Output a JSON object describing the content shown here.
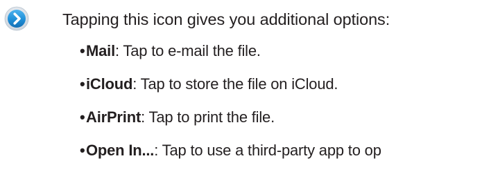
{
  "icon": {
    "name": "disclosure-chevron-icon",
    "fill_color": "#1f8fd8",
    "ring_color": "#d5dde6",
    "glyph_color": "#ffffff"
  },
  "intro_text": "Tapping this icon gives you additional options:",
  "options": [
    {
      "bullet": "•",
      "name": "Mail",
      "separator": ":",
      "description": " Tap to e-mail the file."
    },
    {
      "bullet": "•",
      "name": "iCloud",
      "separator": ":",
      "description": " Tap to store the file on iCloud."
    },
    {
      "bullet": "•",
      "name": "AirPrint",
      "separator": ":",
      "description": " Tap to print the file."
    },
    {
      "bullet": "•",
      "name": "Open In...",
      "separator": ":",
      "description": " Tap to use a third-party app to op"
    }
  ]
}
